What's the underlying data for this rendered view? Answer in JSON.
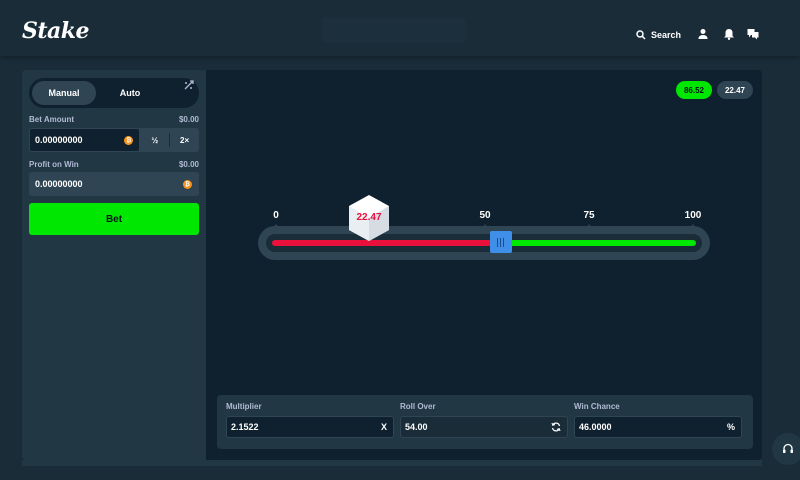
{
  "header": {
    "logo": "Stake",
    "search_label": "Search",
    "icons": [
      "search-icon",
      "user-icon",
      "bell-icon",
      "chat-icon"
    ]
  },
  "sidebar": {
    "tabs": [
      {
        "label": "Manual",
        "active": true
      },
      {
        "label": "Auto",
        "active": false
      }
    ],
    "bet_amount": {
      "label": "Bet Amount",
      "usd": "$0.00",
      "value": "0.00000000",
      "half": "½",
      "double": "2×"
    },
    "profit": {
      "label": "Profit on Win",
      "usd": "$0.00",
      "value": "0.00000000"
    },
    "bet_button": "Bet"
  },
  "results": [
    {
      "value": "86.52",
      "win": true
    },
    {
      "value": "22.47",
      "win": false
    }
  ],
  "slider": {
    "scale": [
      "0",
      "50",
      "75",
      "100"
    ],
    "roll_result": "22.47",
    "roll_over_value": 54,
    "result_value": 22.47
  },
  "controls": {
    "multiplier": {
      "label": "Multiplier",
      "value": "2.1522",
      "suffix": "X"
    },
    "roll_over": {
      "label": "Roll Over",
      "value": "54.00"
    },
    "win_chance": {
      "label": "Win Chance",
      "value": "46.0000",
      "suffix": "%"
    }
  },
  "colors": {
    "accent_green": "#00e701",
    "loss_red": "#e9113c",
    "handle_blue": "#3f8ee8",
    "coin_orange": "#f7931a"
  }
}
